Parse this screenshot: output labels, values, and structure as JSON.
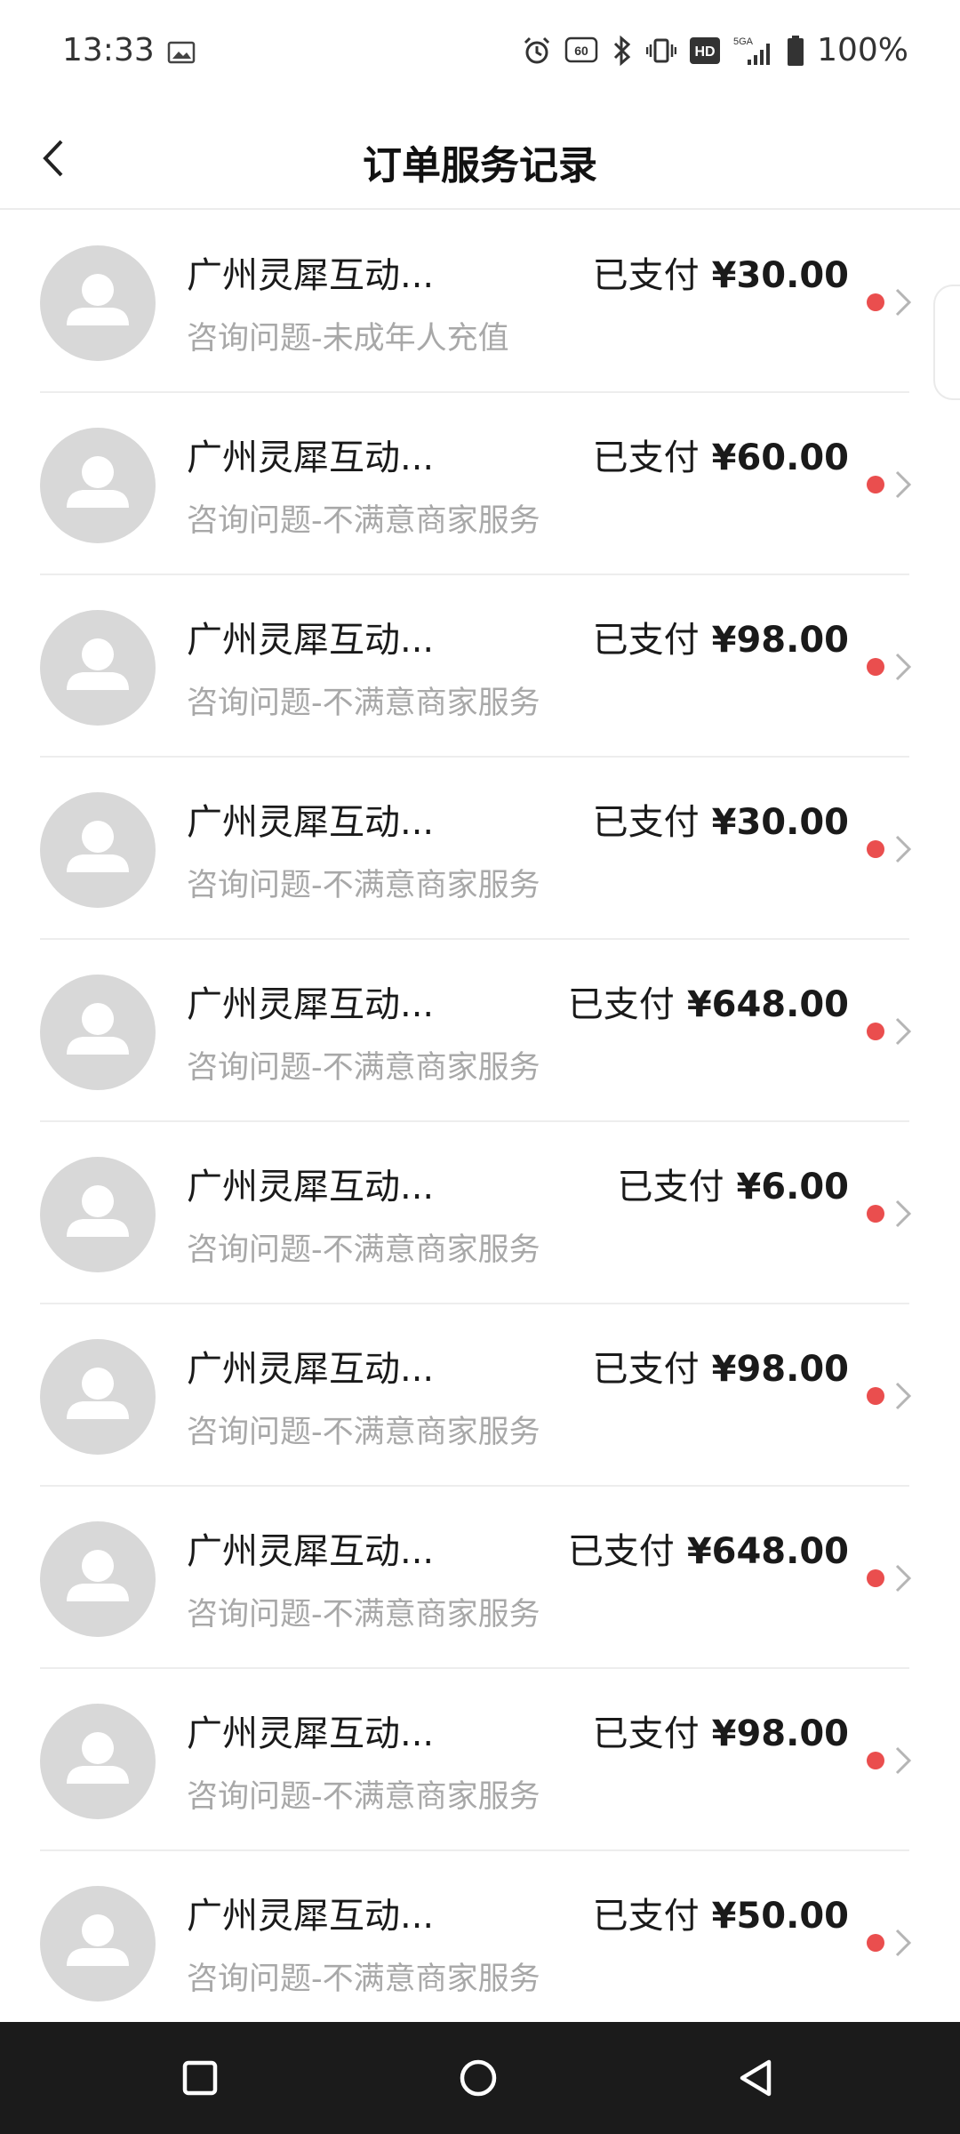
{
  "status_bar": {
    "time": "13:33",
    "battery": "100%",
    "icons": [
      "image-icon",
      "alarm-icon",
      "refresh-rate-60hz-icon",
      "bluetooth-icon",
      "vibrate-icon",
      "hd-icon",
      "signal-5ga-icon",
      "battery-icon"
    ],
    "refresh_label": "60",
    "hd_label": "HD",
    "network_label": "5GA"
  },
  "header": {
    "title": "订单服务记录",
    "back_icon": "chevron-left-icon"
  },
  "orders": [
    {
      "merchant": "广州灵犀互动...",
      "issue": "咨询问题-未成年人充值",
      "status": "已支付",
      "amount": "¥30.00"
    },
    {
      "merchant": "广州灵犀互动...",
      "issue": "咨询问题-不满意商家服务",
      "status": "已支付",
      "amount": "¥60.00"
    },
    {
      "merchant": "广州灵犀互动...",
      "issue": "咨询问题-不满意商家服务",
      "status": "已支付",
      "amount": "¥98.00"
    },
    {
      "merchant": "广州灵犀互动...",
      "issue": "咨询问题-不满意商家服务",
      "status": "已支付",
      "amount": "¥30.00"
    },
    {
      "merchant": "广州灵犀互动...",
      "issue": "咨询问题-不满意商家服务",
      "status": "已支付",
      "amount": "¥648.00"
    },
    {
      "merchant": "广州灵犀互动...",
      "issue": "咨询问题-不满意商家服务",
      "status": "已支付",
      "amount": "¥6.00"
    },
    {
      "merchant": "广州灵犀互动...",
      "issue": "咨询问题-不满意商家服务",
      "status": "已支付",
      "amount": "¥98.00"
    },
    {
      "merchant": "广州灵犀互动...",
      "issue": "咨询问题-不满意商家服务",
      "status": "已支付",
      "amount": "¥648.00"
    },
    {
      "merchant": "广州灵犀互动...",
      "issue": "咨询问题-不满意商家服务",
      "status": "已支付",
      "amount": "¥98.00"
    },
    {
      "merchant": "广州灵犀互动...",
      "issue": "咨询问题-不满意商家服务",
      "status": "已支付",
      "amount": "¥50.00"
    }
  ],
  "colors": {
    "unread_dot": "#ea4e4e",
    "avatar_bg": "#d8d8d8",
    "secondary_text": "#a8a8a8",
    "nav_bar_bg": "#1b1b1b"
  },
  "nav_bar": {
    "buttons": [
      "recent-apps-icon",
      "home-icon",
      "back-icon"
    ]
  }
}
